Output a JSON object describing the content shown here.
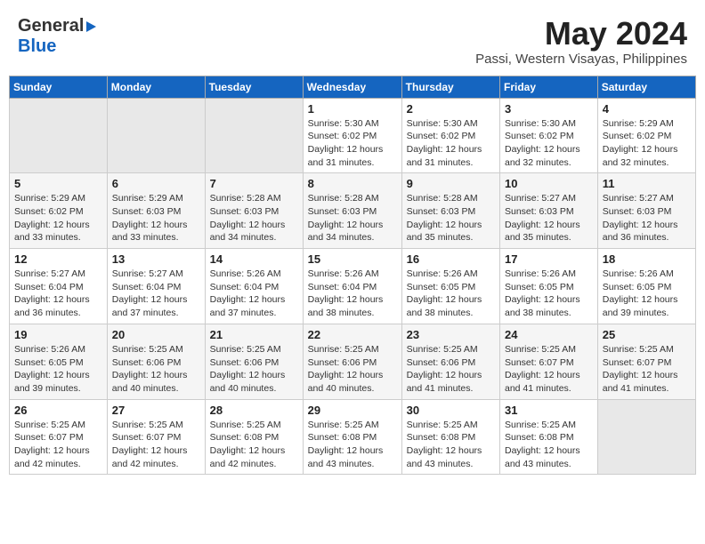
{
  "header": {
    "logo_general": "General",
    "logo_blue": "Blue",
    "month_title": "May 2024",
    "location": "Passi, Western Visayas, Philippines"
  },
  "days": [
    "Sunday",
    "Monday",
    "Tuesday",
    "Wednesday",
    "Thursday",
    "Friday",
    "Saturday"
  ],
  "weeks": [
    [
      {
        "date": "",
        "content": ""
      },
      {
        "date": "",
        "content": ""
      },
      {
        "date": "",
        "content": ""
      },
      {
        "date": "1",
        "content": "Sunrise: 5:30 AM\nSunset: 6:02 PM\nDaylight: 12 hours\nand 31 minutes."
      },
      {
        "date": "2",
        "content": "Sunrise: 5:30 AM\nSunset: 6:02 PM\nDaylight: 12 hours\nand 31 minutes."
      },
      {
        "date": "3",
        "content": "Sunrise: 5:30 AM\nSunset: 6:02 PM\nDaylight: 12 hours\nand 32 minutes."
      },
      {
        "date": "4",
        "content": "Sunrise: 5:29 AM\nSunset: 6:02 PM\nDaylight: 12 hours\nand 32 minutes."
      }
    ],
    [
      {
        "date": "5",
        "content": "Sunrise: 5:29 AM\nSunset: 6:02 PM\nDaylight: 12 hours\nand 33 minutes."
      },
      {
        "date": "6",
        "content": "Sunrise: 5:29 AM\nSunset: 6:03 PM\nDaylight: 12 hours\nand 33 minutes."
      },
      {
        "date": "7",
        "content": "Sunrise: 5:28 AM\nSunset: 6:03 PM\nDaylight: 12 hours\nand 34 minutes."
      },
      {
        "date": "8",
        "content": "Sunrise: 5:28 AM\nSunset: 6:03 PM\nDaylight: 12 hours\nand 34 minutes."
      },
      {
        "date": "9",
        "content": "Sunrise: 5:28 AM\nSunset: 6:03 PM\nDaylight: 12 hours\nand 35 minutes."
      },
      {
        "date": "10",
        "content": "Sunrise: 5:27 AM\nSunset: 6:03 PM\nDaylight: 12 hours\nand 35 minutes."
      },
      {
        "date": "11",
        "content": "Sunrise: 5:27 AM\nSunset: 6:03 PM\nDaylight: 12 hours\nand 36 minutes."
      }
    ],
    [
      {
        "date": "12",
        "content": "Sunrise: 5:27 AM\nSunset: 6:04 PM\nDaylight: 12 hours\nand 36 minutes."
      },
      {
        "date": "13",
        "content": "Sunrise: 5:27 AM\nSunset: 6:04 PM\nDaylight: 12 hours\nand 37 minutes."
      },
      {
        "date": "14",
        "content": "Sunrise: 5:26 AM\nSunset: 6:04 PM\nDaylight: 12 hours\nand 37 minutes."
      },
      {
        "date": "15",
        "content": "Sunrise: 5:26 AM\nSunset: 6:04 PM\nDaylight: 12 hours\nand 38 minutes."
      },
      {
        "date": "16",
        "content": "Sunrise: 5:26 AM\nSunset: 6:05 PM\nDaylight: 12 hours\nand 38 minutes."
      },
      {
        "date": "17",
        "content": "Sunrise: 5:26 AM\nSunset: 6:05 PM\nDaylight: 12 hours\nand 38 minutes."
      },
      {
        "date": "18",
        "content": "Sunrise: 5:26 AM\nSunset: 6:05 PM\nDaylight: 12 hours\nand 39 minutes."
      }
    ],
    [
      {
        "date": "19",
        "content": "Sunrise: 5:26 AM\nSunset: 6:05 PM\nDaylight: 12 hours\nand 39 minutes."
      },
      {
        "date": "20",
        "content": "Sunrise: 5:25 AM\nSunset: 6:06 PM\nDaylight: 12 hours\nand 40 minutes."
      },
      {
        "date": "21",
        "content": "Sunrise: 5:25 AM\nSunset: 6:06 PM\nDaylight: 12 hours\nand 40 minutes."
      },
      {
        "date": "22",
        "content": "Sunrise: 5:25 AM\nSunset: 6:06 PM\nDaylight: 12 hours\nand 40 minutes."
      },
      {
        "date": "23",
        "content": "Sunrise: 5:25 AM\nSunset: 6:06 PM\nDaylight: 12 hours\nand 41 minutes."
      },
      {
        "date": "24",
        "content": "Sunrise: 5:25 AM\nSunset: 6:07 PM\nDaylight: 12 hours\nand 41 minutes."
      },
      {
        "date": "25",
        "content": "Sunrise: 5:25 AM\nSunset: 6:07 PM\nDaylight: 12 hours\nand 41 minutes."
      }
    ],
    [
      {
        "date": "26",
        "content": "Sunrise: 5:25 AM\nSunset: 6:07 PM\nDaylight: 12 hours\nand 42 minutes."
      },
      {
        "date": "27",
        "content": "Sunrise: 5:25 AM\nSunset: 6:07 PM\nDaylight: 12 hours\nand 42 minutes."
      },
      {
        "date": "28",
        "content": "Sunrise: 5:25 AM\nSunset: 6:08 PM\nDaylight: 12 hours\nand 42 minutes."
      },
      {
        "date": "29",
        "content": "Sunrise: 5:25 AM\nSunset: 6:08 PM\nDaylight: 12 hours\nand 43 minutes."
      },
      {
        "date": "30",
        "content": "Sunrise: 5:25 AM\nSunset: 6:08 PM\nDaylight: 12 hours\nand 43 minutes."
      },
      {
        "date": "31",
        "content": "Sunrise: 5:25 AM\nSunset: 6:08 PM\nDaylight: 12 hours\nand 43 minutes."
      },
      {
        "date": "",
        "content": ""
      }
    ]
  ]
}
